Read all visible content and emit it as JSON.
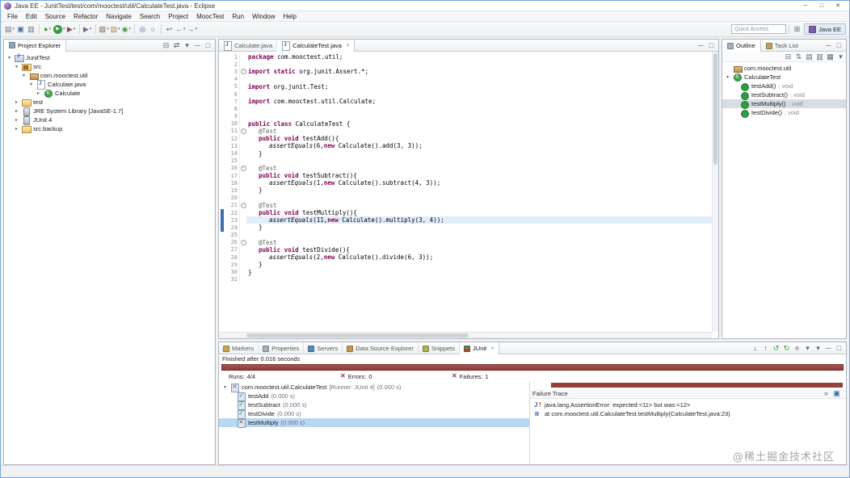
{
  "window": {
    "title": "Java EE - JunitTest/test/com/mooctest/util/CalculateTest.java - Eclipse",
    "controls": {
      "minimize": "─",
      "maximize": "□",
      "close": "✕"
    }
  },
  "menu": {
    "items": [
      "File",
      "Edit",
      "Source",
      "Refactor",
      "Navigate",
      "Search",
      "Project",
      "MoocTest",
      "Run",
      "Window",
      "Help"
    ]
  },
  "toolbar": {
    "quick_access_placeholder": "Quick Access",
    "perspective_java_ee": "Java EE",
    "icons": [
      {
        "name": "new-wizard-icon",
        "g": "▤",
        "c": "#5f7283",
        "dd": true
      },
      {
        "name": "save-icon",
        "g": "▣",
        "c": "#44699e"
      },
      {
        "name": "print-icon",
        "g": "▥",
        "c": "#5f7283"
      },
      {
        "sep": true
      },
      {
        "name": "debug-icon",
        "g": "●",
        "c": "#4a9b3f",
        "dd": true
      },
      {
        "name": "run-icon",
        "g": "▶",
        "dd": true
      },
      {
        "name": "run-external-tools-icon",
        "g": "▶",
        "c": "#8a4a4a",
        "dd": true
      },
      {
        "sep": true
      },
      {
        "name": "coverage-icon",
        "g": "▶",
        "c": "#7d5fa0",
        "dd": true
      },
      {
        "sep": true
      },
      {
        "name": "new-java-project-icon",
        "g": "▧",
        "c": "#7a5f3a",
        "dd": true
      },
      {
        "name": "new-package-icon",
        "g": "▨",
        "c": "#b5884a",
        "dd": true
      },
      {
        "name": "new-class-icon",
        "g": "◉",
        "c": "#3f9b4f",
        "dd": true
      },
      {
        "sep": true
      },
      {
        "name": "open-type-icon",
        "g": "◎",
        "c": "#44699e"
      },
      {
        "name": "search-icon",
        "g": "○",
        "c": "#555555"
      },
      {
        "sep": true
      },
      {
        "name": "last-edit-location-icon",
        "g": "↩",
        "c": "#666666"
      },
      {
        "name": "back-icon",
        "g": "←",
        "c": "#666666",
        "dd": true
      },
      {
        "name": "forward-icon",
        "g": "→",
        "c": "#666666",
        "dd": true
      }
    ]
  },
  "project_explorer": {
    "title": "Project Explorer",
    "tools": [
      {
        "name": "collapse-all-icon",
        "g": "⊟"
      },
      {
        "name": "link-with-editor-icon",
        "g": "⇄"
      },
      {
        "name": "view-menu-icon",
        "g": "▾"
      },
      {
        "name": "minimize-icon",
        "g": "─"
      },
      {
        "name": "maximize-icon",
        "g": "□"
      }
    ],
    "tree": [
      {
        "label": "JunitTest",
        "depth": 0,
        "icon": "project",
        "arrow": "open"
      },
      {
        "label": "src",
        "depth": 1,
        "icon": "srcfolder",
        "arrow": "open"
      },
      {
        "label": "com.mooctest.util",
        "depth": 2,
        "icon": "package",
        "arrow": "open"
      },
      {
        "label": "Calculate.java",
        "depth": 3,
        "icon": "jfile",
        "arrow": "open"
      },
      {
        "label": "Calculate",
        "depth": 4,
        "icon": "class",
        "arrow": "closed"
      },
      {
        "label": "test",
        "depth": 1,
        "icon": "folder",
        "arrow": "closed"
      },
      {
        "label": "JRE System Library [JavaSE-1.7]",
        "depth": 1,
        "icon": "library",
        "arrow": "closed"
      },
      {
        "label": "JUnit 4",
        "depth": 1,
        "icon": "library",
        "arrow": "closed"
      },
      {
        "label": "src.backup",
        "depth": 1,
        "icon": "folder",
        "arrow": "closed"
      }
    ]
  },
  "editor": {
    "tabs": [
      {
        "label": "Calculate.java",
        "active": false
      },
      {
        "label": "CalculateTest.java",
        "active": true
      }
    ],
    "tools": [
      {
        "name": "minimize-icon",
        "g": "─"
      },
      {
        "name": "maximize-icon",
        "g": "□"
      }
    ],
    "lines": [
      {
        "n": 1,
        "tok": [
          [
            "kw",
            "package"
          ],
          [
            "pl",
            " com.mooctest.util;"
          ]
        ]
      },
      {
        "n": 2
      },
      {
        "n": 3,
        "fold": true,
        "tok": [
          [
            "kw",
            "import static"
          ],
          [
            "pl",
            " org.junit.Assert.*;"
          ]
        ]
      },
      {
        "n": 4
      },
      {
        "n": 5,
        "tok": [
          [
            "kw",
            "import"
          ],
          [
            "pl",
            " org.junit.Test;"
          ]
        ]
      },
      {
        "n": 6
      },
      {
        "n": 7,
        "tok": [
          [
            "kw",
            "import"
          ],
          [
            "pl",
            " com.mooctest.util.Calculate;"
          ]
        ]
      },
      {
        "n": 8
      },
      {
        "n": 9
      },
      {
        "n": 10,
        "tok": [
          [
            "kw",
            "public"
          ],
          [
            "pl",
            " "
          ],
          [
            "kw",
            "class"
          ],
          [
            "pl",
            " CalculateTest {"
          ]
        ]
      },
      {
        "n": 11,
        "ind": 1,
        "fold": true,
        "tok": [
          [
            "an",
            "@Test"
          ]
        ]
      },
      {
        "n": 12,
        "ind": 1,
        "tok": [
          [
            "kw",
            "public"
          ],
          [
            "pl",
            " "
          ],
          [
            "kw",
            "void"
          ],
          [
            "pl",
            " testAdd(){"
          ]
        ]
      },
      {
        "n": 13,
        "ind": 2,
        "tok": [
          [
            "st",
            "assertEquals"
          ],
          [
            "pl",
            "(6,"
          ],
          [
            "kw",
            "new"
          ],
          [
            "pl",
            " Calculate().add(3, 3));"
          ]
        ]
      },
      {
        "n": 14,
        "ind": 1,
        "tok": [
          [
            "pl",
            "}"
          ]
        ]
      },
      {
        "n": 15
      },
      {
        "n": 16,
        "ind": 1,
        "fold": true,
        "tok": [
          [
            "an",
            "@Test"
          ]
        ]
      },
      {
        "n": 17,
        "ind": 1,
        "tok": [
          [
            "kw",
            "public"
          ],
          [
            "pl",
            " "
          ],
          [
            "kw",
            "void"
          ],
          [
            "pl",
            " testSubtract(){"
          ]
        ]
      },
      {
        "n": 18,
        "ind": 2,
        "tok": [
          [
            "st",
            "assertEquals"
          ],
          [
            "pl",
            "(1,"
          ],
          [
            "kw",
            "new"
          ],
          [
            "pl",
            " Calculate().subtract(4, 3));"
          ]
        ]
      },
      {
        "n": 19,
        "ind": 1,
        "tok": [
          [
            "pl",
            "}"
          ]
        ]
      },
      {
        "n": 20
      },
      {
        "n": 21,
        "ind": 1,
        "fold": true,
        "tok": [
          [
            "an",
            "@Test"
          ]
        ]
      },
      {
        "n": 22,
        "ind": 1,
        "range": true,
        "tok": [
          [
            "kw",
            "public"
          ],
          [
            "pl",
            " "
          ],
          [
            "kw",
            "void"
          ],
          [
            "pl",
            " testMultiply(){"
          ]
        ]
      },
      {
        "n": 23,
        "ind": 2,
        "cur": true,
        "range": true,
        "tok": [
          [
            "st",
            "assertEquals"
          ],
          [
            "pl",
            "(11,"
          ],
          [
            "kw",
            "new"
          ],
          [
            "pl",
            " Calculate().multiply(3, 4));"
          ]
        ]
      },
      {
        "n": 24,
        "ind": 1,
        "range": true,
        "tok": [
          [
            "pl",
            "}"
          ]
        ]
      },
      {
        "n": 25
      },
      {
        "n": 26,
        "ind": 1,
        "fold": true,
        "tok": [
          [
            "an",
            "@Test"
          ]
        ]
      },
      {
        "n": 27,
        "ind": 1,
        "tok": [
          [
            "kw",
            "public"
          ],
          [
            "pl",
            " "
          ],
          [
            "kw",
            "void"
          ],
          [
            "pl",
            " testDivide(){"
          ]
        ]
      },
      {
        "n": 28,
        "ind": 2,
        "tok": [
          [
            "st",
            "assertEquals"
          ],
          [
            "pl",
            "(2,"
          ],
          [
            "kw",
            "new"
          ],
          [
            "pl",
            " Calculate().divide(6, 3));"
          ]
        ]
      },
      {
        "n": 29,
        "ind": 1,
        "tok": [
          [
            "pl",
            "}"
          ]
        ]
      },
      {
        "n": 30,
        "tok": [
          [
            "pl",
            "}"
          ]
        ]
      },
      {
        "n": 31
      }
    ]
  },
  "outline": {
    "tabs": [
      {
        "label": "Outline",
        "active": true,
        "icon": "outline"
      },
      {
        "label": "Task List",
        "active": false,
        "icon": "task-list"
      }
    ],
    "header_tools": [
      {
        "name": "minimize-icon",
        "g": "─"
      },
      {
        "name": "maximize-icon",
        "g": "□"
      }
    ],
    "tools": [
      {
        "name": "collapse-all-icon",
        "g": "⊟"
      },
      {
        "name": "sort-icon",
        "g": "⇅"
      },
      {
        "name": "hide-fields-icon",
        "g": "▤"
      },
      {
        "name": "hide-static-members-icon",
        "g": "▥"
      },
      {
        "name": "hide-non-public-members-icon",
        "g": "▦"
      },
      {
        "name": "view-menu-icon",
        "g": "▾"
      }
    ],
    "items": [
      {
        "label": "com.mooctest.util",
        "suffix": "",
        "depth": 0,
        "icon": "package",
        "arrow": "none",
        "sel": false
      },
      {
        "label": "CalculateTest",
        "suffix": "",
        "depth": 0,
        "icon": "class",
        "arrow": "open",
        "sel": false
      },
      {
        "label": "testAdd()",
        "suffix": " : void",
        "depth": 1,
        "icon": "method",
        "arrow": "none",
        "sel": false
      },
      {
        "label": "testSubtract()",
        "suffix": " : void",
        "depth": 1,
        "icon": "method",
        "arrow": "none",
        "sel": false
      },
      {
        "label": "testMultiply()",
        "suffix": " : void",
        "depth": 1,
        "icon": "method",
        "arrow": "none",
        "sel": true
      },
      {
        "label": "testDivide()",
        "suffix": " : void",
        "depth": 1,
        "icon": "method",
        "arrow": "none",
        "sel": false
      }
    ]
  },
  "bottom": {
    "tabs": [
      {
        "label": "Markers",
        "icon": "markers",
        "active": false
      },
      {
        "label": "Properties",
        "icon": "properties",
        "active": false
      },
      {
        "label": "Servers",
        "icon": "servers",
        "active": false
      },
      {
        "label": "Data Source Explorer",
        "icon": "data-source-explorer",
        "active": false
      },
      {
        "label": "Snippets",
        "icon": "snippets",
        "active": false
      },
      {
        "label": "JUnit",
        "icon": "junit",
        "active": true
      }
    ],
    "tools": [
      {
        "name": "show-next-failure-icon",
        "g": "↓",
        "c": "#3a66ad"
      },
      {
        "name": "show-previous-failure-icon",
        "g": "↑",
        "c": "#3a66ad"
      },
      {
        "name": "rerun-test-icon",
        "g": "↺",
        "c": "#3f9b4f"
      },
      {
        "name": "rerun-failed-first-icon",
        "g": "↻",
        "c": "#3f9b4f"
      },
      {
        "name": "stop-test-icon",
        "g": "■",
        "c": "#b0b6bc"
      },
      {
        "name": "test-run-history-icon",
        "g": "▾",
        "c": "#5a6b7a"
      },
      {
        "name": "view-menu-icon",
        "g": "▾",
        "c": "#5a6b7a"
      },
      {
        "name": "minimize-icon",
        "g": "─",
        "c": "#5a6b7a"
      },
      {
        "name": "maximize-icon",
        "g": "□",
        "c": "#5a6b7a"
      }
    ]
  },
  "junit": {
    "finished": "Finished after 0.016 seconds",
    "runs_label": "Runs:",
    "runs": "4/4",
    "errors_label": "Errors:",
    "errors": "0",
    "failures_label": "Failures:",
    "failures": "1",
    "tree": {
      "root": {
        "name": "com.mooctest.util.CalculateTest",
        "meta": " [Runner: JUnit 4]",
        "time": " (0.000 s)"
      },
      "cases": [
        {
          "name": "testAdd",
          "time": " (0.000 s)",
          "status": "pass",
          "sel": false
        },
        {
          "name": "testSubtract",
          "time": " (0.000 s)",
          "status": "pass",
          "sel": false
        },
        {
          "name": "testDivide",
          "time": " (0.000 s)",
          "status": "pass",
          "sel": false
        },
        {
          "name": "testMultiply",
          "time": " (0.000 s)",
          "status": "fail",
          "sel": true
        }
      ]
    },
    "failure_trace": {
      "title": "Failure Trace",
      "tools": [
        {
          "name": "stacktrace-filter-icon",
          "g": "»",
          "c": "#3a66ad"
        },
        {
          "name": "compare-result-icon",
          "g": "▣",
          "c": "#3a66ad"
        }
      ],
      "lines": [
        {
          "icon": "assert",
          "text": "java.lang.AssertionError: expected:<11> but was:<12>"
        },
        {
          "icon": "stack",
          "text": "at com.mooctest.util.CalculateTest.testMultiply(CalculateTest.java:23)"
        }
      ]
    }
  },
  "watermark": "@稀土掘金技术社区"
}
